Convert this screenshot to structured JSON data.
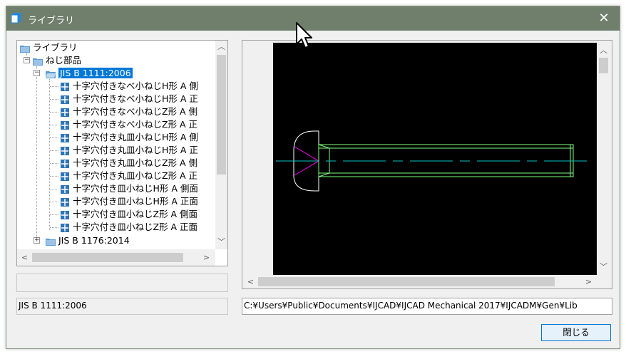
{
  "window": {
    "title": "ライブラリ",
    "close_glyph": "✕"
  },
  "tree": {
    "root": "ライブラリ",
    "category": "ねじ部品",
    "selected_node": "JIS B 1111:2006",
    "items": [
      "十字穴付きなべ小ねじH形 A 側",
      "十字穴付きなべ小ねじH形 A 正",
      "十字穴付きなべ小ねじZ形 A 側",
      "十字穴付きなべ小ねじZ形 A 正",
      "十字穴付き丸皿小ねじH形 A 側",
      "十字穴付き丸皿小ねじH形 A 正",
      "十字穴付き丸皿小ねじZ形 A 側",
      "十字穴付き丸皿小ねじZ形 A 正",
      "十字穴付き皿小ねじH形 A 側面",
      "十字穴付き皿小ねじH形 A 正面",
      "十字穴付き皿小ねじZ形 A 側面",
      "十字穴付き皿小ねじZ形 A 正面"
    ],
    "next_node": "JIS B 1176:2014"
  },
  "selected_label": "JIS B 1111:2006",
  "file_path": "C:¥Users¥Public¥Documents¥IJCAD¥IJCAD Mechanical 2017¥IJCADM¥Gen¥Lib",
  "buttons": {
    "close": "閉じる"
  },
  "colors": {
    "titlebar": "#6f7f6b",
    "selection": "#0078d7",
    "canvas_bg": "#000000",
    "part_outline": "#ffffff",
    "thread_lines": "#7fff7f",
    "center_line": "#00c0c0",
    "cross_recess": "#ff00ff"
  },
  "icons": {
    "title": "library-app-icon",
    "folder": "folder-icon",
    "block": "block-file-icon"
  }
}
